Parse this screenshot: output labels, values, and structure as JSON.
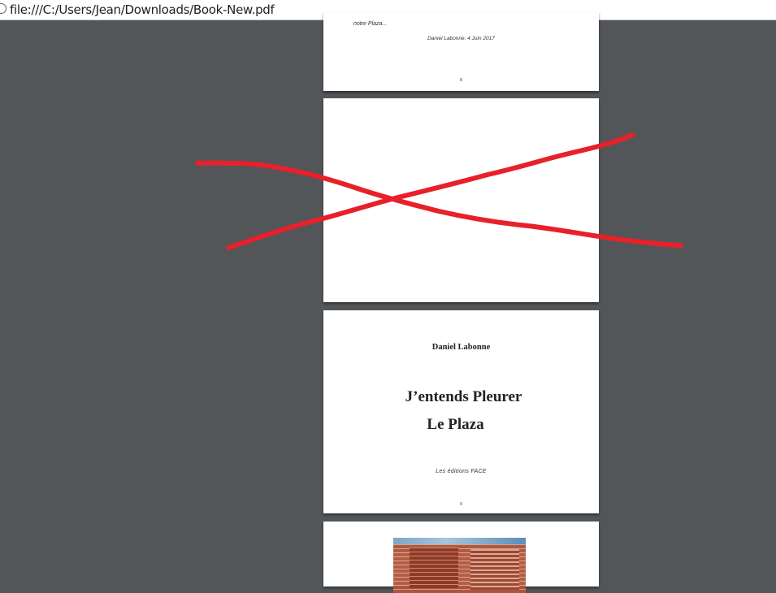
{
  "address_bar": {
    "url": "file:///C:/Users/Jean/Downloads/Book-New.pdf"
  },
  "pages": {
    "page_8": {
      "excerpt": "notre Plaza...",
      "signature": "Daniel Labonne. 4 Juin 2017",
      "number": "8"
    },
    "page_9": {
      "author": "Daniel Labonne",
      "title_line_1": "J’entends Pleurer",
      "title_line_2": "Le Plaza",
      "publisher": "Les éditions FACE",
      "number": "9"
    }
  },
  "annotation": {
    "color": "#e8202a"
  }
}
